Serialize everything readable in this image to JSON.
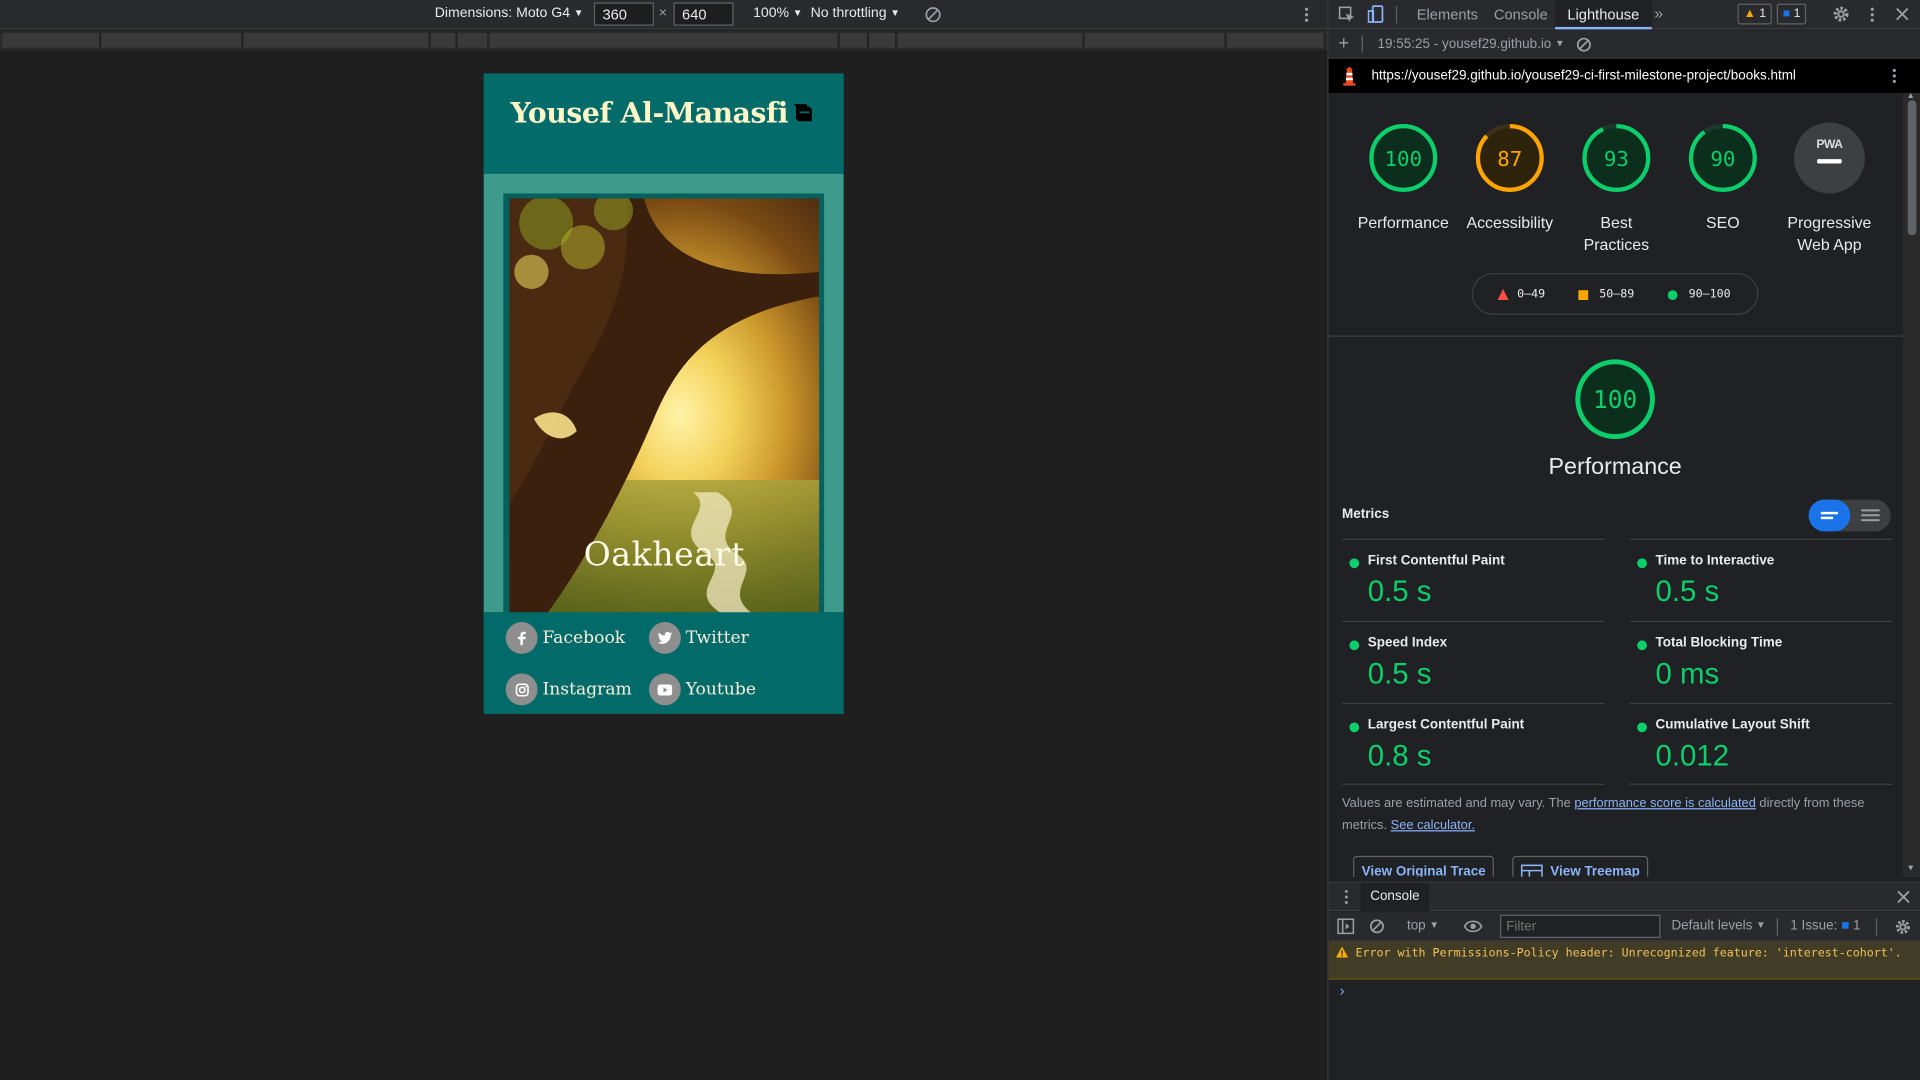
{
  "device_toolbar": {
    "dimensions_label": "Dimensions: Moto G4",
    "width_value": "360",
    "times_sign": "×",
    "height_value": "640",
    "zoom": "100%",
    "throttling": "No throttling"
  },
  "site": {
    "brand": "Yousef Al-Manasfi",
    "cover_title": "Oakheart",
    "socials": [
      "Facebook",
      "Twitter",
      "Instagram",
      "Youtube"
    ]
  },
  "devtools": {
    "tabs": [
      "Elements",
      "Console",
      "Lighthouse"
    ],
    "active_tab": "Lighthouse",
    "warnings_count": "1",
    "messages_count": "1",
    "report_selector": "19:55:25 - yousef29.github.io",
    "report_url": "https://yousef29.github.io/yousef29-ci-first-milestone-project/books.html"
  },
  "lighthouse": {
    "gauges": [
      {
        "score": "100",
        "label": "Performance",
        "color": "#0cce6b",
        "fraction": 1.0
      },
      {
        "score": "87",
        "label": "Accessibility",
        "color": "#ffa400",
        "fraction": 0.87
      },
      {
        "score": "93",
        "label": "Best Practices",
        "color": "#0cce6b",
        "fraction": 0.93
      },
      {
        "score": "90",
        "label": "SEO",
        "color": "#0cce6b",
        "fraction": 0.9
      }
    ],
    "pwa": {
      "badge": "PWA",
      "label": "Progressive Web App"
    },
    "legend": [
      {
        "range": "0–49",
        "color": "#ff4e42"
      },
      {
        "range": "50–89",
        "color": "#ffa400"
      },
      {
        "range": "90–100",
        "color": "#0cce6b"
      }
    ],
    "performance_score": "100",
    "performance_title": "Performance",
    "metrics_header": "Metrics",
    "metrics": [
      {
        "name": "First Contentful Paint",
        "value": "0.5 s"
      },
      {
        "name": "Time to Interactive",
        "value": "0.5 s"
      },
      {
        "name": "Speed Index",
        "value": "0.5 s"
      },
      {
        "name": "Total Blocking Time",
        "value": "0 ms"
      },
      {
        "name": "Largest Contentful Paint",
        "value": "0.8 s"
      },
      {
        "name": "Cumulative Layout Shift",
        "value": "0.012"
      }
    ],
    "note_prefix": "Values are estimated and may vary. The ",
    "note_link1": "performance score is calculated",
    "note_middle": " directly from these metrics. ",
    "note_link2": "See calculator.",
    "btn_trace": "View Original Trace",
    "btn_treemap": "View Treemap"
  },
  "console": {
    "tab": "Console",
    "context": "top",
    "filter_placeholder": "Filter",
    "levels": "Default levels",
    "issues": "1 Issue:",
    "issues_count": "1",
    "warning": "Error with Permissions-Policy header: Unrecognized feature: 'interest-cohort'.",
    "prompt": "›"
  },
  "colors": {
    "good": "#0cce6b",
    "average": "#ffa400",
    "fail": "#ff4e42",
    "link": "#8ab4f8",
    "teal": "#036a6a"
  }
}
